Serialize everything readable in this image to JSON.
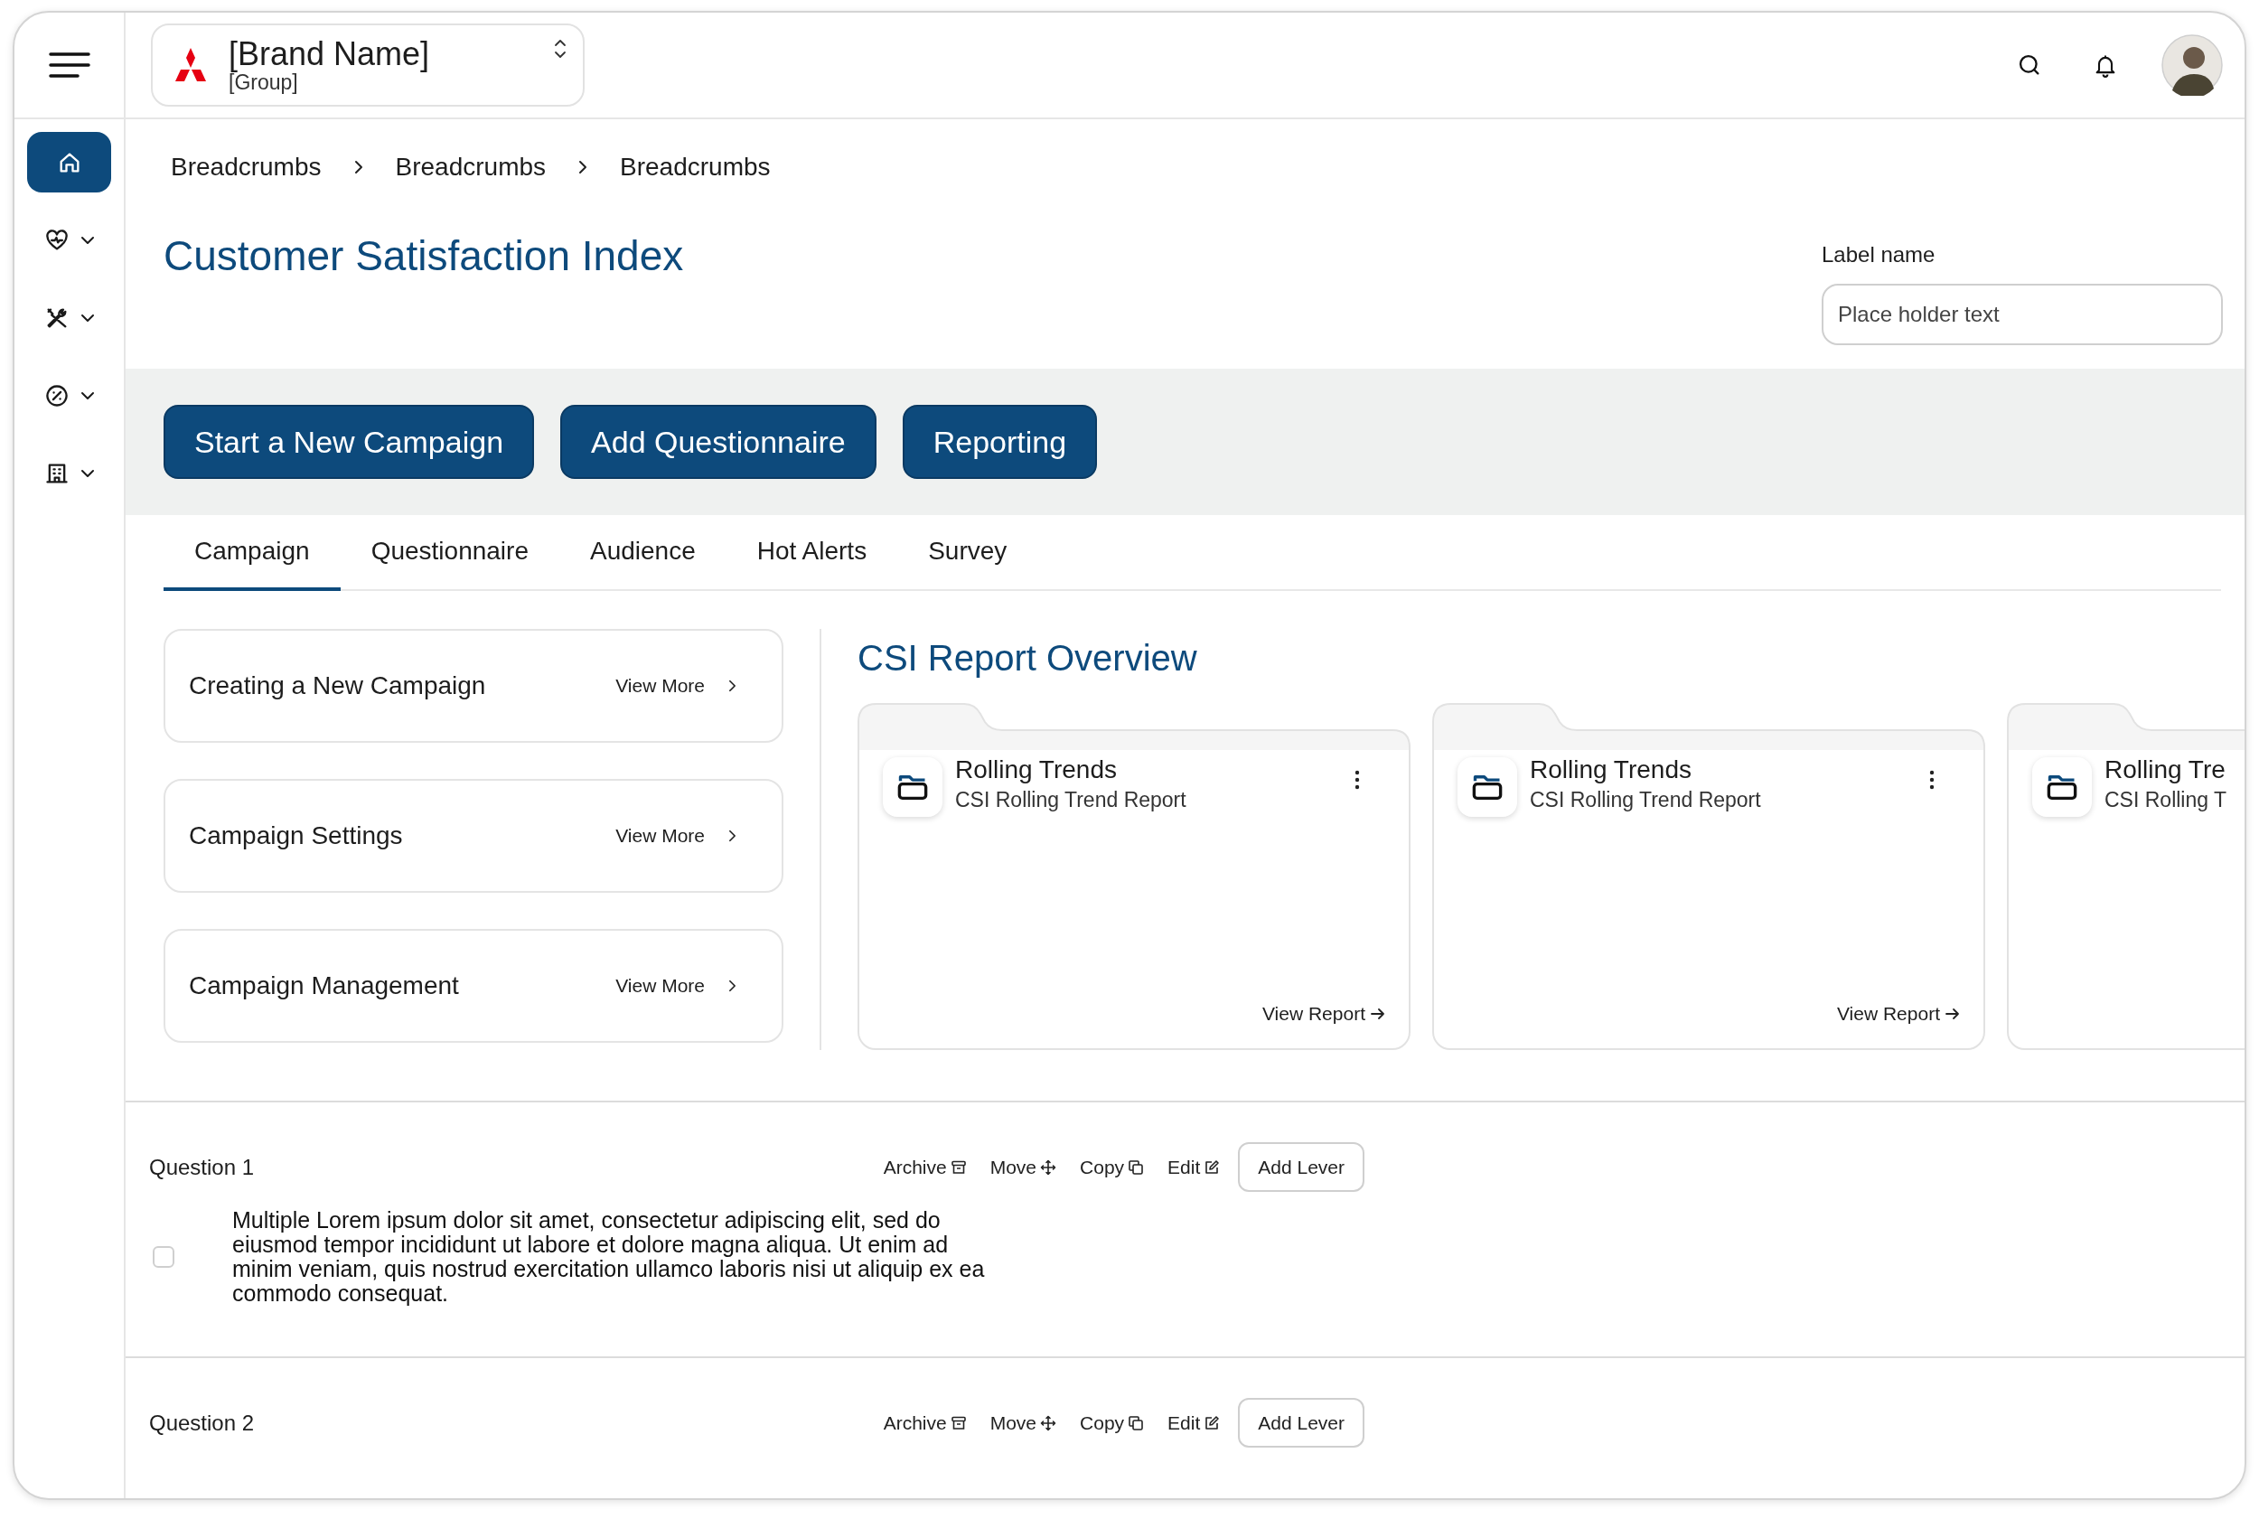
{
  "brand": {
    "name": "[Brand Name]",
    "group": "[Group]"
  },
  "sidebar": {
    "items": [
      {
        "selected": true,
        "expandable": false
      },
      {
        "selected": false,
        "expandable": true
      },
      {
        "selected": false,
        "expandable": true
      },
      {
        "selected": false,
        "expandable": true
      },
      {
        "selected": false,
        "expandable": true
      }
    ]
  },
  "breadcrumbs": [
    "Breadcrumbs",
    "Breadcrumbs",
    "Breadcrumbs"
  ],
  "page_title": "Customer Satisfaction Index",
  "field": {
    "label": "Label name",
    "placeholder": "Place holder text"
  },
  "action_buttons": [
    "Start a New Campaign",
    "Add Questionnaire",
    "Reporting"
  ],
  "tabs": [
    {
      "label": "Campaign",
      "selected": true
    },
    {
      "label": "Questionnaire",
      "selected": false
    },
    {
      "label": "Audience",
      "selected": false
    },
    {
      "label": "Hot Alerts",
      "selected": false
    },
    {
      "label": "Survey",
      "selected": false
    }
  ],
  "topics": [
    {
      "title": "Creating a New Campaign",
      "link": "View More"
    },
    {
      "title": "Campaign Settings",
      "link": "View More"
    },
    {
      "title": "Campaign Management",
      "link": "View More"
    }
  ],
  "report_overview": {
    "title": "CSI Report Overview",
    "cards": [
      {
        "title": "Rolling Trends",
        "subtitle": "CSI Rolling Trend Report",
        "link": "View Report"
      },
      {
        "title": "Rolling Trends",
        "subtitle": "CSI Rolling Trend Report",
        "link": "View Report"
      },
      {
        "title": "Rolling Tre",
        "subtitle": "CSI Rolling T"
      }
    ]
  },
  "questions": [
    {
      "title": "Question 1",
      "actions": [
        {
          "label": "Archive",
          "kind": "archive"
        },
        {
          "label": "Move",
          "kind": "move"
        },
        {
          "label": "Copy",
          "kind": "copy"
        },
        {
          "label": "Edit",
          "kind": "edit"
        },
        {
          "label": "Add Lever",
          "kind": "outlined"
        }
      ],
      "option": {
        "text": "Multiple Lorem ipsum dolor sit amet, consectetur adipiscing elit, sed do eiusmod tempor incididunt ut labore et dolore magna aliqua. Ut enim ad minim veniam, quis nostrud exercitation ullamco laboris nisi ut aliquip ex ea commodo consequat.",
        "checked": false
      }
    },
    {
      "title": "Question 2",
      "actions": [
        {
          "label": "Archive",
          "kind": "archive"
        },
        {
          "label": "Move",
          "kind": "move"
        },
        {
          "label": "Copy",
          "kind": "copy"
        },
        {
          "label": "Edit",
          "kind": "edit"
        },
        {
          "label": "Add Lever",
          "kind": "outlined"
        }
      ]
    }
  ]
}
